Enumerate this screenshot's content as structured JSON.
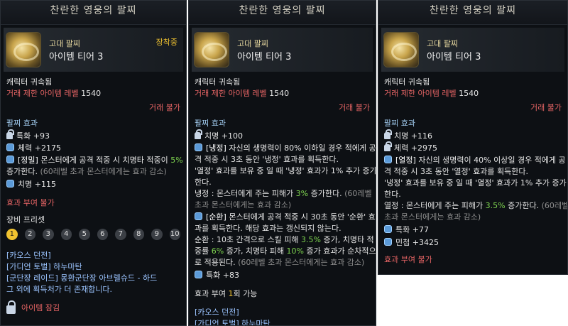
{
  "panels": [
    {
      "title": "찬란한 영웅의 팔찌",
      "grade": "고대 팔찌",
      "tier": "아이템 티어 3",
      "equipped": "장착중",
      "bound": "캐릭터 귀속됨",
      "trade_label": "거래 제한 아이템 레벨",
      "trade_level": "1540",
      "untradeable": "거래 불가",
      "effect_title": "팔찌 효과",
      "stats": [
        {
          "label": "특화 +93",
          "icon": "lock-icon"
        },
        {
          "label": "체력 +2175",
          "icon": "shield-icon"
        }
      ],
      "special_tag": "[정밀]",
      "special_text_1": "몬스터에게 공격 적중 시 치명타 적중이",
      "special_value": "5%",
      "special_text_2": "증가한다.",
      "special_note": "(60레벨 초과 몬스터에게는 효과 감소)",
      "stat_after": "치명 +115",
      "reforge": "효과 부여 불가",
      "preset_title": "장비 프리셋",
      "presets": [
        "1",
        "2",
        "3",
        "4",
        "5",
        "6",
        "7",
        "8",
        "9",
        "10"
      ],
      "sources": [
        "[카오스 던전]",
        "[가디언 토벌] 하누마탄",
        "[군단장 레이드] 몽환군단장 아브렐슈드 - 하드",
        "그 외에 획득처가 더 존재합니다."
      ],
      "lock_text": "아이템 잠김"
    },
    {
      "title": "찬란한 영웅의 팔찌",
      "grade": "고대 팔찌",
      "tier": "아이템 티어 3",
      "bound": "캐릭터 귀속됨",
      "trade_label": "거래 제한 아이템 레벨",
      "trade_level": "1540",
      "untradeable": "거래 불가",
      "effect_title": "팔찌 효과",
      "stat1": "치명 +100",
      "cold_tag": "[냉정]",
      "cold_lines": [
        "자신의 생명력이 80% 이하일 경우 적에게 공",
        "격 적중 시 3초 동안 '냉정' 효과를 획득한다.",
        "'열정' 효과를 보유 중 일 때 '냉정' 효과가 1% 추가 증가",
        "한다."
      ],
      "cold_effect_pre": "냉정 : 몬스터에게 주는 피해가",
      "cold_effect_val": "3%",
      "cold_effect_post": "증가한다.",
      "cold_note_1": "(60레벨",
      "cold_note_2": "초과 몬스터에게는 효과 감소)",
      "cycle_tag": "[순환]",
      "cycle_lines": [
        "몬스터에게 공격 적중 시 30초 동안 '순환' 효",
        "과를 획득한다. 해당 효과는 갱신되지 않는다."
      ],
      "cycle_e1": "순환 : 10초 간격으로 스킬 피해",
      "cycle_v1": "3.5%",
      "cycle_e2": "증가, 치명타 적",
      "cycle_e3": "중률",
      "cycle_v2": "6%",
      "cycle_e4": "증가, 치명타 피해",
      "cycle_v3": "10%",
      "cycle_e5": "증가 효과가 순차적으",
      "cycle_e6": "로 적용된다.",
      "cycle_note": "(60레벨 초과 몬스터에게는 효과 감소)",
      "stat2": "특화 +83",
      "reforge_pre": "효과 부여",
      "reforge_val": "1",
      "reforge_post": "회 가능",
      "sources": [
        "[카오스 던전]",
        "[가디언 토벌] 하누마탄"
      ]
    },
    {
      "title": "찬란한 영웅의 팔찌",
      "grade": "고대 팔찌",
      "tier": "아이템 티어 3",
      "bound": "캐릭터 귀속됨",
      "trade_label": "거래 제한 아이템 레벨",
      "trade_level": "1540",
      "untradeable": "거래 불가",
      "effect_title": "팔찌 효과",
      "stat1": "치명 +116",
      "stat2": "체력 +2975",
      "passion_tag": "[열정]",
      "passion_lines": [
        "자신의 생명력이 40% 이상일 경우 적에게 공",
        "격 적중 시 3초 동안 '열정' 효과를 획득한다.",
        "'냉정' 효과를 보유 중 일 때 '열정' 효과가 1% 추가 증가",
        "한다."
      ],
      "passion_e_pre": "열정 : 몬스터에게 주는 피해가",
      "passion_e_val": "3.5%",
      "passion_e_post": "증가한다.",
      "passion_note_1": "(60레벨",
      "passion_note_2": "초과 몬스터에게는 효과 감소)",
      "stat3": "특화 +77",
      "stat4": "민첩 +3425",
      "reforge": "효과 부여 불가"
    }
  ]
}
